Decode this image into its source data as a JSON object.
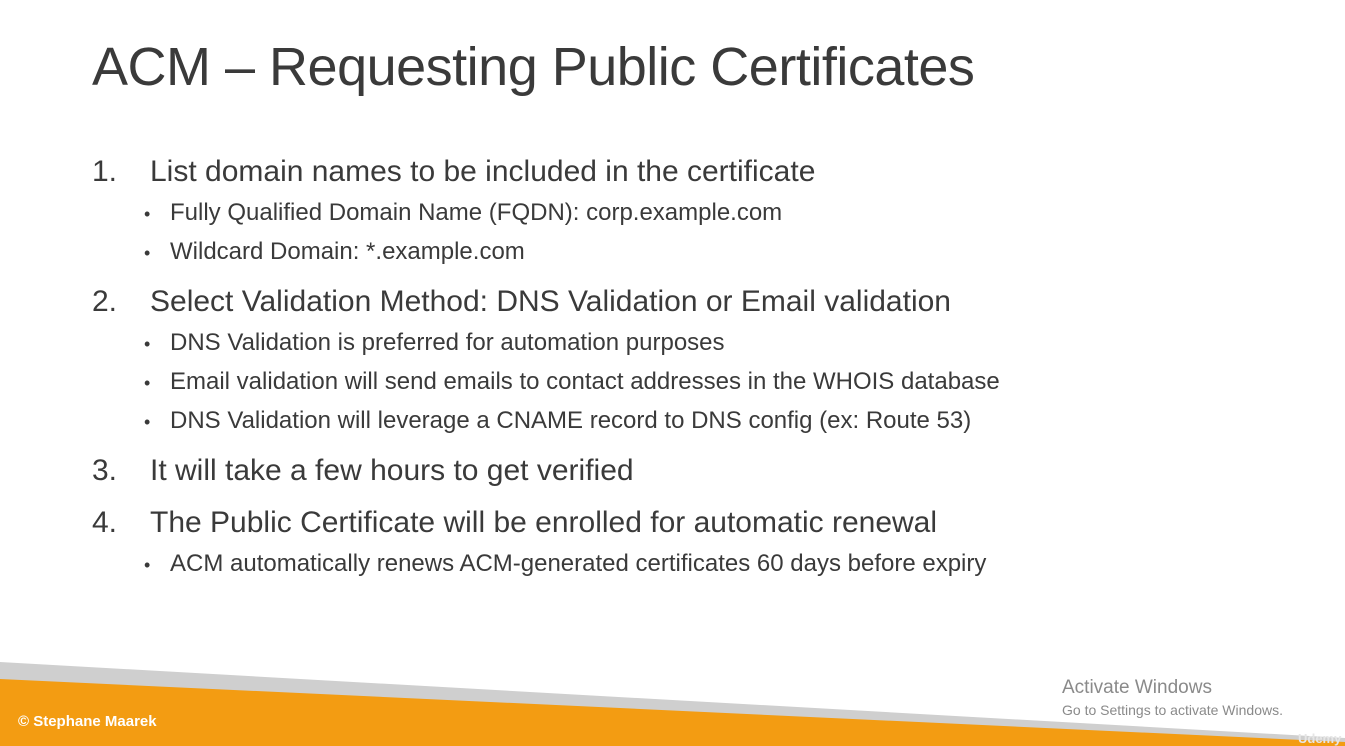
{
  "title": "ACM – Requesting Public Certificates",
  "steps": [
    {
      "number": "1.",
      "text": "List domain names to be included in the certificate",
      "bullets": [
        "Fully Qualified Domain Name (FQDN): corp.example.com",
        "Wildcard Domain: *.example.com"
      ]
    },
    {
      "number": "2.",
      "text": "Select Validation Method: DNS Validation or Email validation",
      "bullets": [
        "DNS Validation is preferred for automation purposes",
        "Email validation will send emails to contact addresses in the WHOIS database",
        "DNS Validation will leverage a CNAME record to DNS config (ex: Route 53)"
      ]
    },
    {
      "number": "3.",
      "text": "It will take a few hours to get verified",
      "bullets": []
    },
    {
      "number": "4.",
      "text": "The Public Certificate will be enrolled for automatic renewal",
      "bullets": [
        "ACM automatically renews ACM-generated certificates 60 days before expiry"
      ]
    }
  ],
  "bullet_glyph": "•",
  "footer": {
    "copyright": "© Stephane Maarek",
    "watermark": "Udemy"
  },
  "activate_windows": {
    "title": "Activate Windows",
    "subtitle": "Go to Settings to activate Windows."
  },
  "colors": {
    "accent_orange": "#f39c12",
    "footer_gray": "#c9c9c9",
    "text": "#3a3a3a"
  }
}
